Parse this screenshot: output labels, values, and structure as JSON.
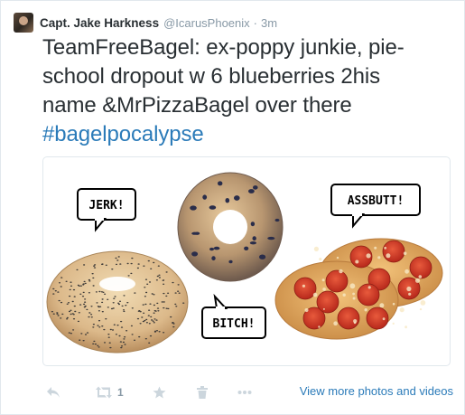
{
  "author": {
    "name": "Capt. Jake Harkness",
    "handle": "@IcarusPhoenix",
    "separator": "·",
    "time": "3m"
  },
  "tweet": {
    "text_line1": "TeamFreeBagel: ex-poppy junkie, pie-",
    "text_line2": "school dropout w 6 blueberries 2his",
    "text_line3": "name &MrPizzaBagel over there",
    "hashtag": "#bagelpocalypse"
  },
  "media": {
    "bubbles": {
      "jerk": "JERK!",
      "assbutt": "ASSBUTT!",
      "bitch": "BITCH!"
    }
  },
  "actions": {
    "retweet_count": "1",
    "more_label": "View more photos and videos"
  },
  "colors": {
    "link": "#2b7bb9",
    "text": "#292f33",
    "muted": "#8899a6",
    "icon": "#ccd6dd"
  },
  "icons": [
    "reply-icon",
    "retweet-icon",
    "favorite-icon",
    "delete-icon",
    "more-icon"
  ]
}
